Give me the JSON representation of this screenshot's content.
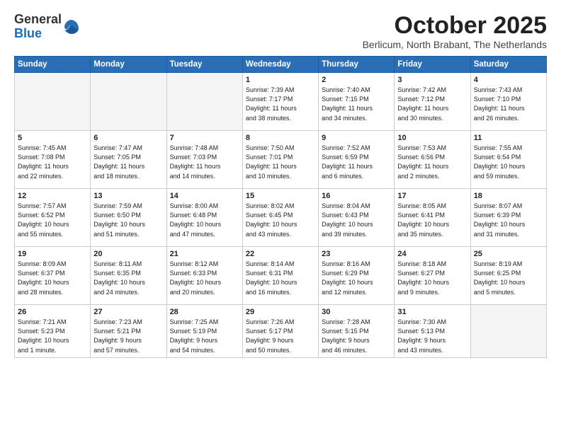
{
  "logo": {
    "general": "General",
    "blue": "Blue"
  },
  "title": "October 2025",
  "subtitle": "Berlicum, North Brabant, The Netherlands",
  "days_of_week": [
    "Sunday",
    "Monday",
    "Tuesday",
    "Wednesday",
    "Thursday",
    "Friday",
    "Saturday"
  ],
  "weeks": [
    [
      {
        "day": "",
        "info": "",
        "empty": true
      },
      {
        "day": "",
        "info": "",
        "empty": true
      },
      {
        "day": "",
        "info": "",
        "empty": true
      },
      {
        "day": "1",
        "info": "Sunrise: 7:39 AM\nSunset: 7:17 PM\nDaylight: 11 hours\nand 38 minutes."
      },
      {
        "day": "2",
        "info": "Sunrise: 7:40 AM\nSunset: 7:15 PM\nDaylight: 11 hours\nand 34 minutes."
      },
      {
        "day": "3",
        "info": "Sunrise: 7:42 AM\nSunset: 7:12 PM\nDaylight: 11 hours\nand 30 minutes."
      },
      {
        "day": "4",
        "info": "Sunrise: 7:43 AM\nSunset: 7:10 PM\nDaylight: 11 hours\nand 26 minutes."
      }
    ],
    [
      {
        "day": "5",
        "info": "Sunrise: 7:45 AM\nSunset: 7:08 PM\nDaylight: 11 hours\nand 22 minutes."
      },
      {
        "day": "6",
        "info": "Sunrise: 7:47 AM\nSunset: 7:05 PM\nDaylight: 11 hours\nand 18 minutes."
      },
      {
        "day": "7",
        "info": "Sunrise: 7:48 AM\nSunset: 7:03 PM\nDaylight: 11 hours\nand 14 minutes."
      },
      {
        "day": "8",
        "info": "Sunrise: 7:50 AM\nSunset: 7:01 PM\nDaylight: 11 hours\nand 10 minutes."
      },
      {
        "day": "9",
        "info": "Sunrise: 7:52 AM\nSunset: 6:59 PM\nDaylight: 11 hours\nand 6 minutes."
      },
      {
        "day": "10",
        "info": "Sunrise: 7:53 AM\nSunset: 6:56 PM\nDaylight: 11 hours\nand 2 minutes."
      },
      {
        "day": "11",
        "info": "Sunrise: 7:55 AM\nSunset: 6:54 PM\nDaylight: 10 hours\nand 59 minutes."
      }
    ],
    [
      {
        "day": "12",
        "info": "Sunrise: 7:57 AM\nSunset: 6:52 PM\nDaylight: 10 hours\nand 55 minutes."
      },
      {
        "day": "13",
        "info": "Sunrise: 7:59 AM\nSunset: 6:50 PM\nDaylight: 10 hours\nand 51 minutes."
      },
      {
        "day": "14",
        "info": "Sunrise: 8:00 AM\nSunset: 6:48 PM\nDaylight: 10 hours\nand 47 minutes."
      },
      {
        "day": "15",
        "info": "Sunrise: 8:02 AM\nSunset: 6:45 PM\nDaylight: 10 hours\nand 43 minutes."
      },
      {
        "day": "16",
        "info": "Sunrise: 8:04 AM\nSunset: 6:43 PM\nDaylight: 10 hours\nand 39 minutes."
      },
      {
        "day": "17",
        "info": "Sunrise: 8:05 AM\nSunset: 6:41 PM\nDaylight: 10 hours\nand 35 minutes."
      },
      {
        "day": "18",
        "info": "Sunrise: 8:07 AM\nSunset: 6:39 PM\nDaylight: 10 hours\nand 31 minutes."
      }
    ],
    [
      {
        "day": "19",
        "info": "Sunrise: 8:09 AM\nSunset: 6:37 PM\nDaylight: 10 hours\nand 28 minutes."
      },
      {
        "day": "20",
        "info": "Sunrise: 8:11 AM\nSunset: 6:35 PM\nDaylight: 10 hours\nand 24 minutes."
      },
      {
        "day": "21",
        "info": "Sunrise: 8:12 AM\nSunset: 6:33 PM\nDaylight: 10 hours\nand 20 minutes."
      },
      {
        "day": "22",
        "info": "Sunrise: 8:14 AM\nSunset: 6:31 PM\nDaylight: 10 hours\nand 16 minutes."
      },
      {
        "day": "23",
        "info": "Sunrise: 8:16 AM\nSunset: 6:29 PM\nDaylight: 10 hours\nand 12 minutes."
      },
      {
        "day": "24",
        "info": "Sunrise: 8:18 AM\nSunset: 6:27 PM\nDaylight: 10 hours\nand 9 minutes."
      },
      {
        "day": "25",
        "info": "Sunrise: 8:19 AM\nSunset: 6:25 PM\nDaylight: 10 hours\nand 5 minutes."
      }
    ],
    [
      {
        "day": "26",
        "info": "Sunrise: 7:21 AM\nSunset: 5:23 PM\nDaylight: 10 hours\nand 1 minute."
      },
      {
        "day": "27",
        "info": "Sunrise: 7:23 AM\nSunset: 5:21 PM\nDaylight: 9 hours\nand 57 minutes."
      },
      {
        "day": "28",
        "info": "Sunrise: 7:25 AM\nSunset: 5:19 PM\nDaylight: 9 hours\nand 54 minutes."
      },
      {
        "day": "29",
        "info": "Sunrise: 7:26 AM\nSunset: 5:17 PM\nDaylight: 9 hours\nand 50 minutes."
      },
      {
        "day": "30",
        "info": "Sunrise: 7:28 AM\nSunset: 5:15 PM\nDaylight: 9 hours\nand 46 minutes."
      },
      {
        "day": "31",
        "info": "Sunrise: 7:30 AM\nSunset: 5:13 PM\nDaylight: 9 hours\nand 43 minutes."
      },
      {
        "day": "",
        "info": "",
        "empty": true
      }
    ]
  ]
}
